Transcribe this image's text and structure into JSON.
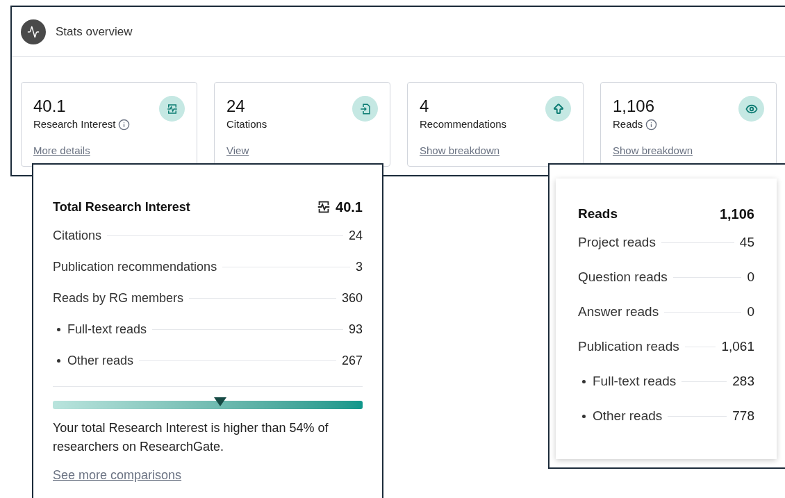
{
  "header": {
    "title": "Stats overview"
  },
  "cards": [
    {
      "kind": "interest",
      "value": "40.1",
      "label": "Research Interest",
      "info": true,
      "link": "More details"
    },
    {
      "kind": "citations",
      "value": "24",
      "label": "Citations",
      "info": false,
      "link": "View"
    },
    {
      "kind": "recommendations",
      "value": "4",
      "label": "Recommendations",
      "info": false,
      "link": "Show breakdown"
    },
    {
      "kind": "reads",
      "value": "1,106",
      "label": "Reads",
      "info": true,
      "link": "Show breakdown"
    }
  ],
  "research_popup": {
    "title": "Total Research Interest",
    "total": "40.1",
    "rows": [
      {
        "label": "Citations",
        "value": "24"
      },
      {
        "label": "Publication recommendations",
        "value": "3"
      },
      {
        "label": "Reads by RG members",
        "value": "360",
        "children": [
          {
            "label": "Full-text reads",
            "value": "93"
          },
          {
            "label": "Other reads",
            "value": "267"
          }
        ]
      }
    ],
    "comparison": {
      "level": 0.54,
      "text": "Your total Research Interest is higher than 54% of researchers on ResearchGate.",
      "link": "See more comparisons"
    }
  },
  "reads_popup": {
    "title": "Reads",
    "total": "1,106",
    "rows": [
      {
        "label": "Project reads",
        "value": "45"
      },
      {
        "label": "Question reads",
        "value": "0"
      },
      {
        "label": "Answer reads",
        "value": "0"
      },
      {
        "label": "Publication reads",
        "value": "1,061",
        "children": [
          {
            "label": "Full-text reads",
            "value": "283"
          },
          {
            "label": "Other reads",
            "value": "778"
          }
        ]
      }
    ]
  }
}
